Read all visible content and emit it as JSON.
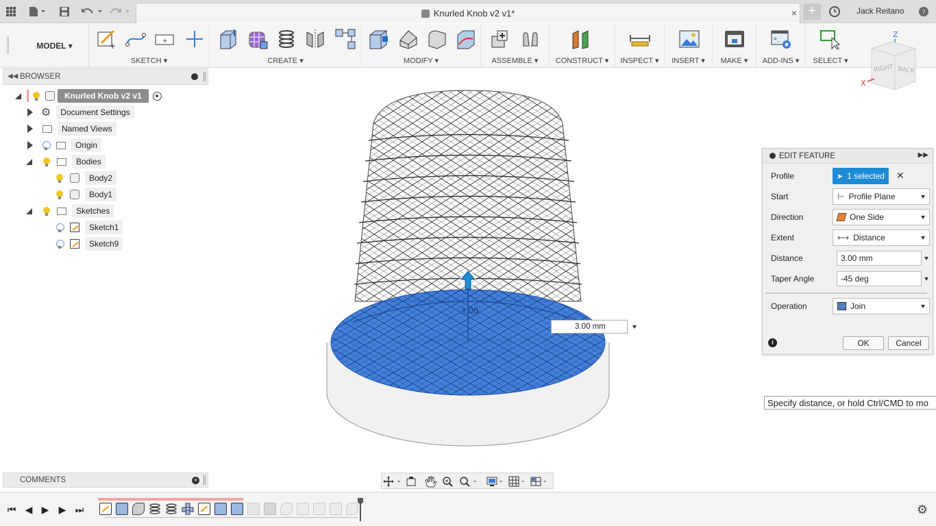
{
  "window": {
    "doc_title": "Knurled Knob v2 v1*",
    "user": "Jack Reitano",
    "close_glyph": "×",
    "new_tab_glyph": "+"
  },
  "toolbar": {
    "workspace": "MODEL ▾",
    "groups": [
      {
        "label": "SKETCH ▾"
      },
      {
        "label": "CREATE ▾"
      },
      {
        "label": "MODIFY ▾"
      },
      {
        "label": "ASSEMBLE ▾"
      },
      {
        "label": "CONSTRUCT ▾"
      },
      {
        "label": "INSPECT ▾"
      },
      {
        "label": "INSERT ▾"
      },
      {
        "label": "MAKE ▾"
      },
      {
        "label": "ADD-INS ▾"
      },
      {
        "label": "SELECT ▾"
      }
    ]
  },
  "viewcube": {
    "top": "Z",
    "x_axis": "X",
    "right_face": "RIGHT",
    "back_face": "BACK"
  },
  "browser": {
    "title": "BROWSER",
    "root": "Knurled Knob v2 v1",
    "items": [
      {
        "label": "Document Settings"
      },
      {
        "label": "Named Views"
      },
      {
        "label": "Origin"
      },
      {
        "label": "Bodies"
      },
      {
        "label": "Body2"
      },
      {
        "label": "Body1"
      },
      {
        "label": "Sketches"
      },
      {
        "label": "Sketch1"
      },
      {
        "label": "Sketch9"
      }
    ]
  },
  "edit_feature": {
    "title": "EDIT FEATURE",
    "rows": [
      {
        "label": "Profile",
        "value": "1 selected"
      },
      {
        "label": "Start",
        "value": "Profile Plane"
      },
      {
        "label": "Direction",
        "value": "One Side"
      },
      {
        "label": "Extent",
        "value": "Distance"
      },
      {
        "label": "Distance",
        "value": "3.00 mm"
      },
      {
        "label": "Taper Angle",
        "value": "-45 deg"
      },
      {
        "label": "Operation",
        "value": "Join"
      }
    ],
    "ok": "OK",
    "cancel": "Cancel",
    "info": "i",
    "clear": "✕"
  },
  "viewport": {
    "distance_input": "3.00 mm",
    "tooltip": "Specify distance, or hold Ctrl/CMD to mo",
    "dimension_label": "3.00",
    "colors": {
      "selection_blue": "#2a6fd6",
      "accent": "#1c8bd6"
    }
  },
  "comments": {
    "title": "COMMENTS"
  },
  "timeline": {
    "controls": [
      "⏮",
      "◀",
      "▶",
      "▶",
      "⏭"
    ]
  }
}
